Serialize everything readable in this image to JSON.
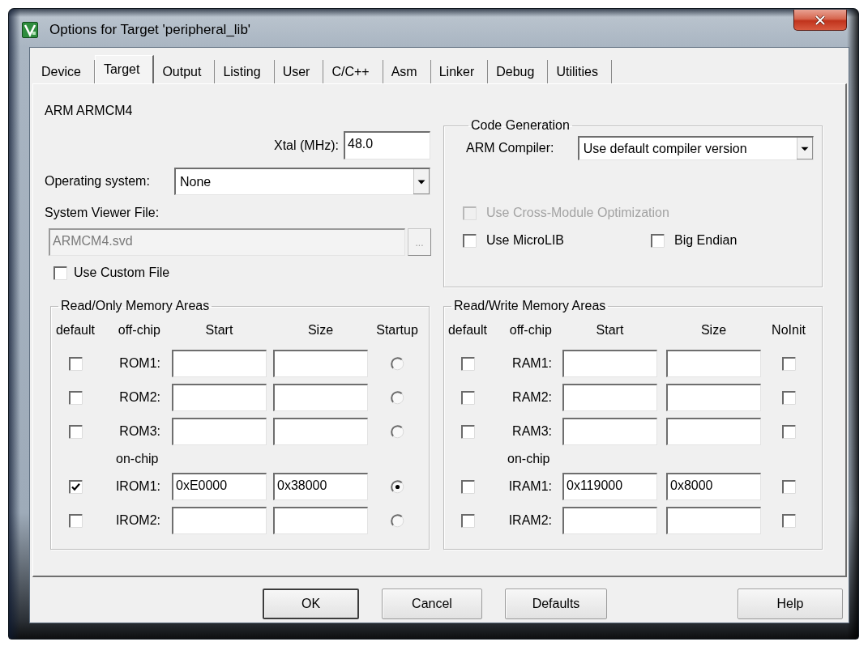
{
  "window": {
    "title": "Options for Target 'peripheral_lib'"
  },
  "tabs": [
    {
      "label": "Device",
      "selected": false
    },
    {
      "label": "Target",
      "selected": true
    },
    {
      "label": "Output",
      "selected": false
    },
    {
      "label": "Listing",
      "selected": false
    },
    {
      "label": "User",
      "selected": false
    },
    {
      "label": "C/C++",
      "selected": false
    },
    {
      "label": "Asm",
      "selected": false
    },
    {
      "label": "Linker",
      "selected": false
    },
    {
      "label": "Debug",
      "selected": false
    },
    {
      "label": "Utilities",
      "selected": false
    }
  ],
  "target": {
    "device": "ARM ARMCM4",
    "xtal": {
      "label": "Xtal (MHz):",
      "value": "48.0"
    },
    "operating_system": {
      "label": "Operating system:",
      "value": "None"
    },
    "system_viewer_file": {
      "label": "System Viewer File:",
      "value": "ARMCM4.svd",
      "browse": "...",
      "disabled": true
    },
    "use_custom_file": {
      "label": "Use Custom File",
      "checked": false
    },
    "code_generation": {
      "title": "Code Generation",
      "compiler": {
        "label": "ARM Compiler:",
        "value": "Use default compiler version"
      },
      "option_rows": [
        [
          {
            "label": "Use Cross-Module Optimization",
            "checked": false,
            "disabled": true
          }
        ],
        [
          {
            "label": "Use MicroLIB",
            "checked": false,
            "disabled": false
          },
          {
            "label": "Big Endian",
            "checked": false,
            "disabled": false
          }
        ]
      ]
    },
    "read_only_memory": {
      "title": "Read/Only Memory Areas",
      "columns": [
        "default",
        "off-chip",
        "Start",
        "Size",
        "Startup"
      ],
      "rows": [
        {
          "kind": "area",
          "label": "ROM1:",
          "checked": false,
          "selected": false
        },
        {
          "kind": "area",
          "label": "ROM2:",
          "checked": false,
          "selected": false
        },
        {
          "kind": "area",
          "label": "ROM3:",
          "checked": false,
          "selected": false
        },
        {
          "kind": "heading",
          "label": "on-chip"
        },
        {
          "kind": "area",
          "label": "IROM1:",
          "checked": true,
          "start": "0xE0000",
          "size": "0x38000",
          "selected": true
        },
        {
          "kind": "area",
          "label": "IROM2:",
          "checked": false,
          "selected": false
        }
      ]
    },
    "read_write_memory": {
      "title": "Read/Write Memory Areas",
      "columns": [
        "default",
        "off-chip",
        "Start",
        "Size",
        "NoInit"
      ],
      "rows": [
        {
          "kind": "area",
          "label": "RAM1:",
          "checked": false,
          "noinit": false
        },
        {
          "kind": "area",
          "label": "RAM2:",
          "checked": false,
          "noinit": false
        },
        {
          "kind": "area",
          "label": "RAM3:",
          "checked": false,
          "noinit": false
        },
        {
          "kind": "heading",
          "label": "on-chip"
        },
        {
          "kind": "area",
          "label": "IRAM1:",
          "checked": false,
          "start": "0x119000",
          "size": "0x8000",
          "noinit": false
        },
        {
          "kind": "area",
          "label": "IRAM2:",
          "checked": false,
          "noinit": false
        }
      ]
    }
  },
  "buttons": [
    {
      "label": "OK",
      "default": true
    },
    {
      "label": "Cancel",
      "default": false
    },
    {
      "label": "Defaults",
      "default": false
    }
  ],
  "help_button": {
    "label": "Help"
  }
}
